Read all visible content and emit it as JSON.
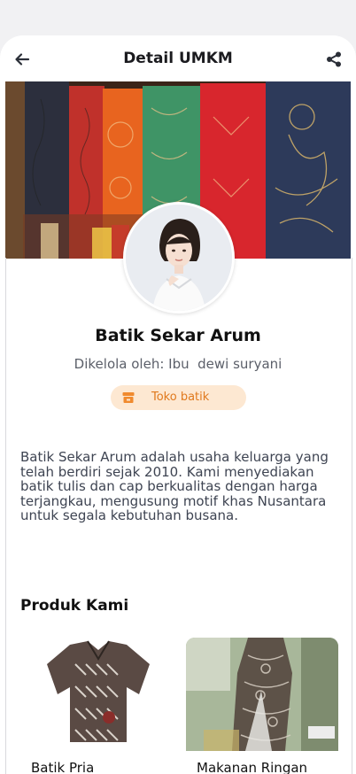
{
  "header": {
    "title": "Detail UMKM",
    "back_icon": "arrow-left-icon",
    "share_icon": "share-icon"
  },
  "profile": {
    "name": "Batik Sekar Arum",
    "owner": "Dikelola oleh: Ibu  dewi suryani",
    "category_badge": "Toko batik",
    "category_icon": "store-icon",
    "description": "Batik Sekar Arum adalah usaha keluarga yang telah berdiri sejak 2010. Kami menyediakan batik tulis dan cap berkualitas dengan harga terjangkau, mengusung motif khas Nusantara untuk segala kebutuhan busana."
  },
  "products_section": {
    "title": "Produk Kami",
    "items": [
      {
        "label": "Batik Pria"
      },
      {
        "label": "Makanan Ringan"
      }
    ]
  },
  "colors": {
    "badge_bg": "#fde8d2",
    "badge_text": "#e0791d"
  }
}
